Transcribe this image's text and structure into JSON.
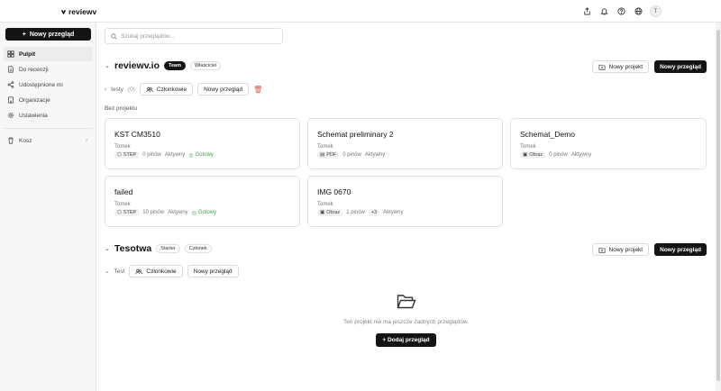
{
  "app": {
    "brand": "reviewv"
  },
  "sidebar": {
    "new_button": "Nowy przegląd",
    "items": [
      {
        "label": "Pulpit"
      },
      {
        "label": "Do recenzji"
      },
      {
        "label": "Udostępnione mi"
      },
      {
        "label": "Organizacje"
      },
      {
        "label": "Ustawienia"
      }
    ],
    "trash": {
      "label": "Kosz"
    }
  },
  "topbar": {
    "avatar_initial": "T"
  },
  "search": {
    "placeholder": "Szukaj przeglądów..."
  },
  "org1": {
    "name": "reviewv.io",
    "plan_badge": "Team",
    "role_badge": "Właściciel",
    "new_project": "Nowy projekt",
    "new_review": "Nowy przegląd",
    "project": {
      "name": "testy",
      "count": "(0)",
      "members": "Członkowie",
      "new_review": "Nowy przegląd"
    },
    "unassigned_label": "Bez projektu",
    "reviews": [
      {
        "title": "KST CM3510",
        "author": "Tomek",
        "type": "STEP",
        "pins": "0 pinów",
        "status": "Aktywny",
        "ready": "Gotowy"
      },
      {
        "title": "Schemat preliminary 2",
        "author": "Tomek",
        "type": "PDF",
        "pins": "0 pinów",
        "status": "Aktywny",
        "ready": ""
      },
      {
        "title": "Schemat_Demo",
        "author": "Tomek",
        "type": "Obraz",
        "pins": "0 pinów",
        "status": "Aktywny",
        "ready": ""
      },
      {
        "title": "failed",
        "author": "Tomek",
        "type": "STEP",
        "pins": "10 pinów",
        "status": "Aktywny",
        "ready": "Gotowy"
      },
      {
        "title": "IMG 0670",
        "author": "Tomek",
        "type": "Obraz",
        "pins": "1 pinów",
        "extra": "+3",
        "status": "Aktywny",
        "ready": ""
      }
    ]
  },
  "org2": {
    "name": "Tesotwa",
    "plan_badge": "Starter",
    "role_badge": "Członek",
    "new_project": "Nowy projekt",
    "new_review": "Nowy przegląd",
    "project": {
      "name": "Test",
      "members": "Członkowie",
      "new_review": "Nowy przegląd"
    },
    "empty_text": "Ten projekt nie ma jeszcze żadnych przeglądów.",
    "add_review": "+ Dodaj przegląd"
  }
}
